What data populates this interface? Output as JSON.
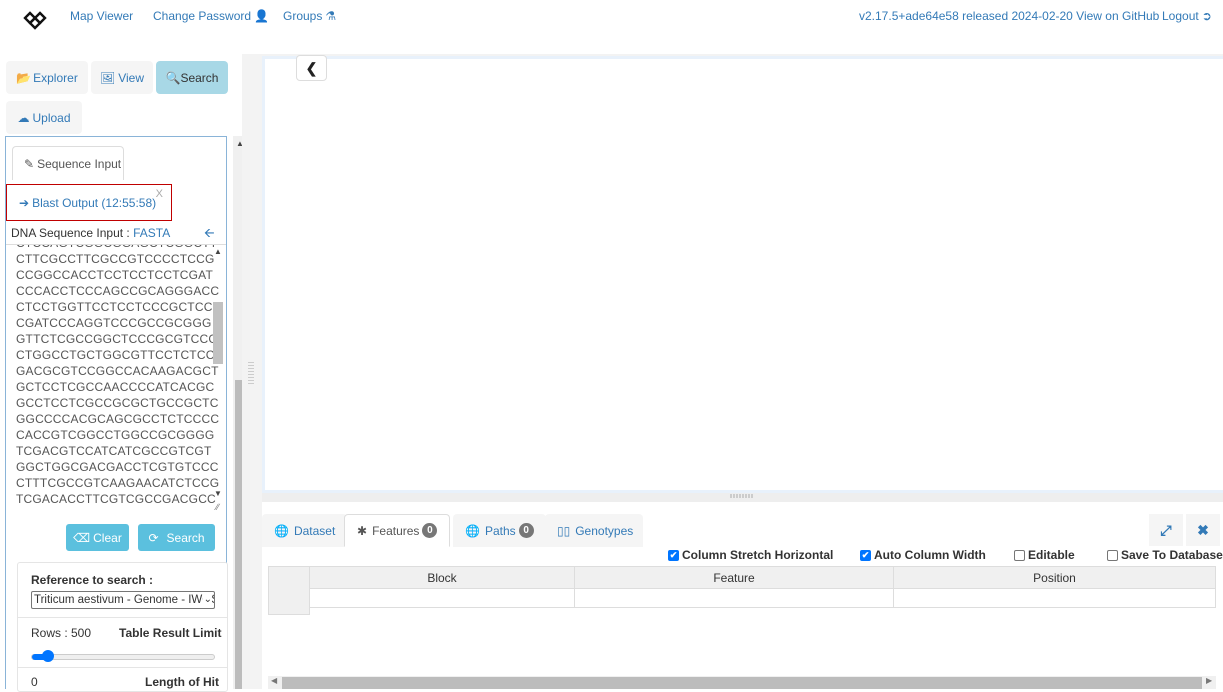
{
  "topbar": {
    "logo": "app-logo",
    "links": [
      {
        "label": "Map Viewer",
        "icon": ""
      },
      {
        "label": "Change Password",
        "icon": "user-icon"
      },
      {
        "label": "Groups",
        "icon": "flask-icon"
      }
    ],
    "version": "v2.17.5+ade64e58 released 2024-02-20 View on GitHub",
    "logout": "Logout"
  },
  "left_tabs": [
    {
      "label": "Explorer",
      "icon": "folder-open-icon",
      "active": false
    },
    {
      "label": "View",
      "icon": "picture-icon",
      "active": false
    },
    {
      "label": "Search",
      "icon": "search-icon",
      "active": true
    },
    {
      "label": "Upload",
      "icon": "cloud-upload-icon",
      "active": false
    }
  ],
  "search_panel": {
    "sequence_tab": "Sequence Input",
    "blast_tab": "Blast Output (12:55:58)",
    "blast_close": "X",
    "dna_label": "DNA Sequence Input : ",
    "dna_format": "FASTA",
    "sequence_lines": [
      "CTCCAGTCGGCGGAGCTCGGCTT",
      "CTTCGCCTTCGCCGTCCCCTCCG",
      "CCGGCCACCTCCTCCTCCTCGAT",
      "CCCACCTCCCAGCCGCAGGGACC",
      "CTCCTGGTTCCTCCTCCCGCTCC",
      "CGATCCCAGGTCCCGCCGCGGG",
      "GTTCTCGCCGGCTCCCGCGTCCG",
      "CTGGCCTGCTGGCGTTCCTCTCC",
      "GACGCGTCCGGCCACAAGACGCT",
      "GCTCCTCGCCAACCCCATCACGC",
      "GCCTCCTCGCCGCGCTGCCGCTC",
      "GGCCCCACGCAGCGCCTCTCCCC",
      "CACCGTCGGCCTGGCCGCGGGG",
      "TCGACGTCCATCATCGCCGTCGT",
      "GGCTGGCGACGACCTCGTGTCCC",
      "CTTTCGCCGTCAAGAACATCTCCG",
      "TCGACACCTTCGTCGCCGACGCC"
    ],
    "clear_button": "Clear",
    "search_button": "Search",
    "reference_label": "Reference to search :",
    "reference_value": "Triticum aestivum - Genome - IWGSC",
    "rows_label": "Rows : 500",
    "rows_value": 500,
    "rows_slider_fraction": 0.09,
    "table_limit_label": "Table Result Limit",
    "length_value": "0",
    "length_label": "Length of Hit"
  },
  "bottom_tabs": [
    {
      "label": "Dataset",
      "icon": "globe-icon",
      "badge": null,
      "active": false
    },
    {
      "label": "Features",
      "icon": "asterisk-icon",
      "badge": "0",
      "active": true
    },
    {
      "label": "Paths",
      "icon": "globe-icon",
      "badge": "0",
      "active": false
    },
    {
      "label": "Genotypes",
      "icon": "barcode-icon",
      "badge": null,
      "active": false
    }
  ],
  "table_options": [
    {
      "label": "Column Stretch Horizontal",
      "checked": true
    },
    {
      "label": "Auto Column Width",
      "checked": true
    },
    {
      "label": "Editable",
      "checked": false
    },
    {
      "label": "Save To Database",
      "checked": false
    }
  ],
  "table": {
    "columns": [
      "Block",
      "Feature",
      "Position"
    ],
    "rows": []
  }
}
